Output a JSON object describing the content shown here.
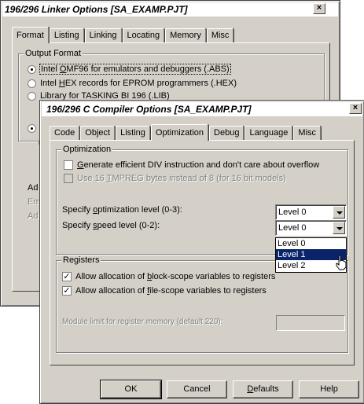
{
  "linker": {
    "title": "196/296 Linker Options [SA_EXAMP.PJT]",
    "close": "×",
    "tabs": [
      "Format",
      "Listing",
      "Linking",
      "Locating",
      "Memory",
      "Misc"
    ],
    "group_label": "Output Format",
    "options": [
      {
        "pre": "Intel ",
        "u": "O",
        "post": "MF96 for emulators and debuggers (.ABS)"
      },
      {
        "pre": "Intel ",
        "u": "H",
        "post": "EX records for EPROM programmers (.HEX)"
      },
      {
        "pre": "Library for TASKING BI 196 (.LIB)",
        "u": "",
        "post": ""
      }
    ],
    "side_labels": [
      "Ad",
      "Em",
      "Ad"
    ]
  },
  "compiler": {
    "title": "196/296 C Compiler Options [SA_EXAMP.PJT]",
    "close": "×",
    "tabs": [
      "Code",
      "Object",
      "Listing",
      "Optimization",
      "Debug",
      "Language",
      "Misc"
    ],
    "optimization_label": "Optimization",
    "div_check": {
      "pre": "",
      "u": "G",
      "post": "enerate efficient DIV instruction and don't care about overflow"
    },
    "tmpreg_check": {
      "pre": "Use 16 ",
      "u": "T",
      "post": "MPREG bytes instead of 8 (for 16 bit models)"
    },
    "opt_level": {
      "pre": "Specify ",
      "u": "o",
      "post": "ptimization level (0-3):",
      "value": "Level 0"
    },
    "speed_level": {
      "pre": "Specify ",
      "u": "s",
      "post": "peed level (0-2):",
      "value": "Level 0"
    },
    "dropdown_options": [
      "Level 0",
      "Level 1",
      "Level 2"
    ],
    "registers_label": "Registers",
    "block_check": {
      "pre": "Allow allocation of ",
      "u": "b",
      "post": "lock-scope variables to registers"
    },
    "file_check": {
      "pre": "Allow allocation of ",
      "u": "f",
      "post": "ile-scope variables to registers"
    },
    "module_limit": "Module limit for register memory (default 220):",
    "buttons": {
      "ok": "OK",
      "cancel": "Cancel",
      "defaults_u": "D",
      "defaults_rest": "efaults",
      "help": "Help"
    }
  }
}
